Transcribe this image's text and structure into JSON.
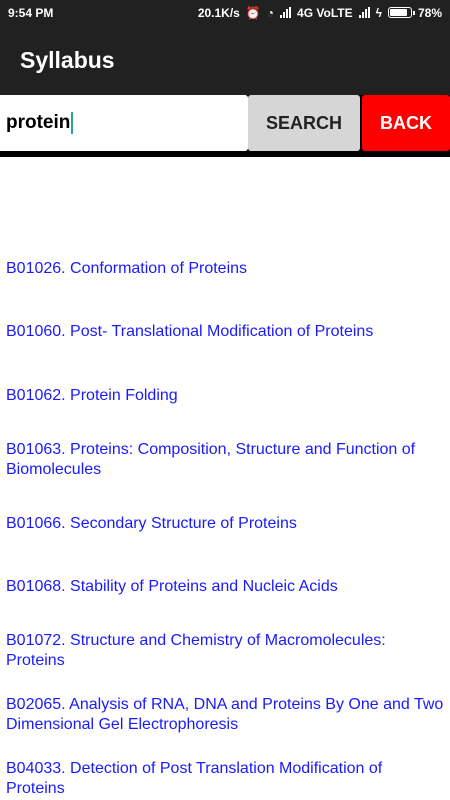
{
  "status_bar": {
    "time": "9:54 PM",
    "net_speed": "20.1K/s",
    "network": "4G VoLTE",
    "battery": "78%",
    "battery_level": 0.78
  },
  "app_bar": {
    "title": "Syllabus"
  },
  "search": {
    "value": "protein",
    "search_label": "SEARCH",
    "back_label": "BACK"
  },
  "colors": {
    "bar_bg": "#212121",
    "link": "#1a1aff",
    "back_button": "#ff0000",
    "search_button": "#d6d6d6"
  },
  "results": [
    {
      "text": "B01026. Conformation of Proteins"
    },
    {
      "text": "B01060. Post- Translational Modification of Proteins"
    },
    {
      "text": "B01062. Protein Folding"
    },
    {
      "text": "B01063. Proteins: Composition, Structure and Function of Biomolecules"
    },
    {
      "text": "B01066. Secondary Structure of Proteins"
    },
    {
      "text": "B01068. Stability of Proteins and Nucleic Acids"
    },
    {
      "text": "B01072. Structure and Chemistry of Macromolecules: Proteins"
    },
    {
      "text": "B02065. Analysis of RNA, DNA  and Proteins By One and Two Dimensional Gel Electrophoresis"
    },
    {
      "text": "B04033. Detection of Post Translation Modification of Proteins"
    }
  ]
}
